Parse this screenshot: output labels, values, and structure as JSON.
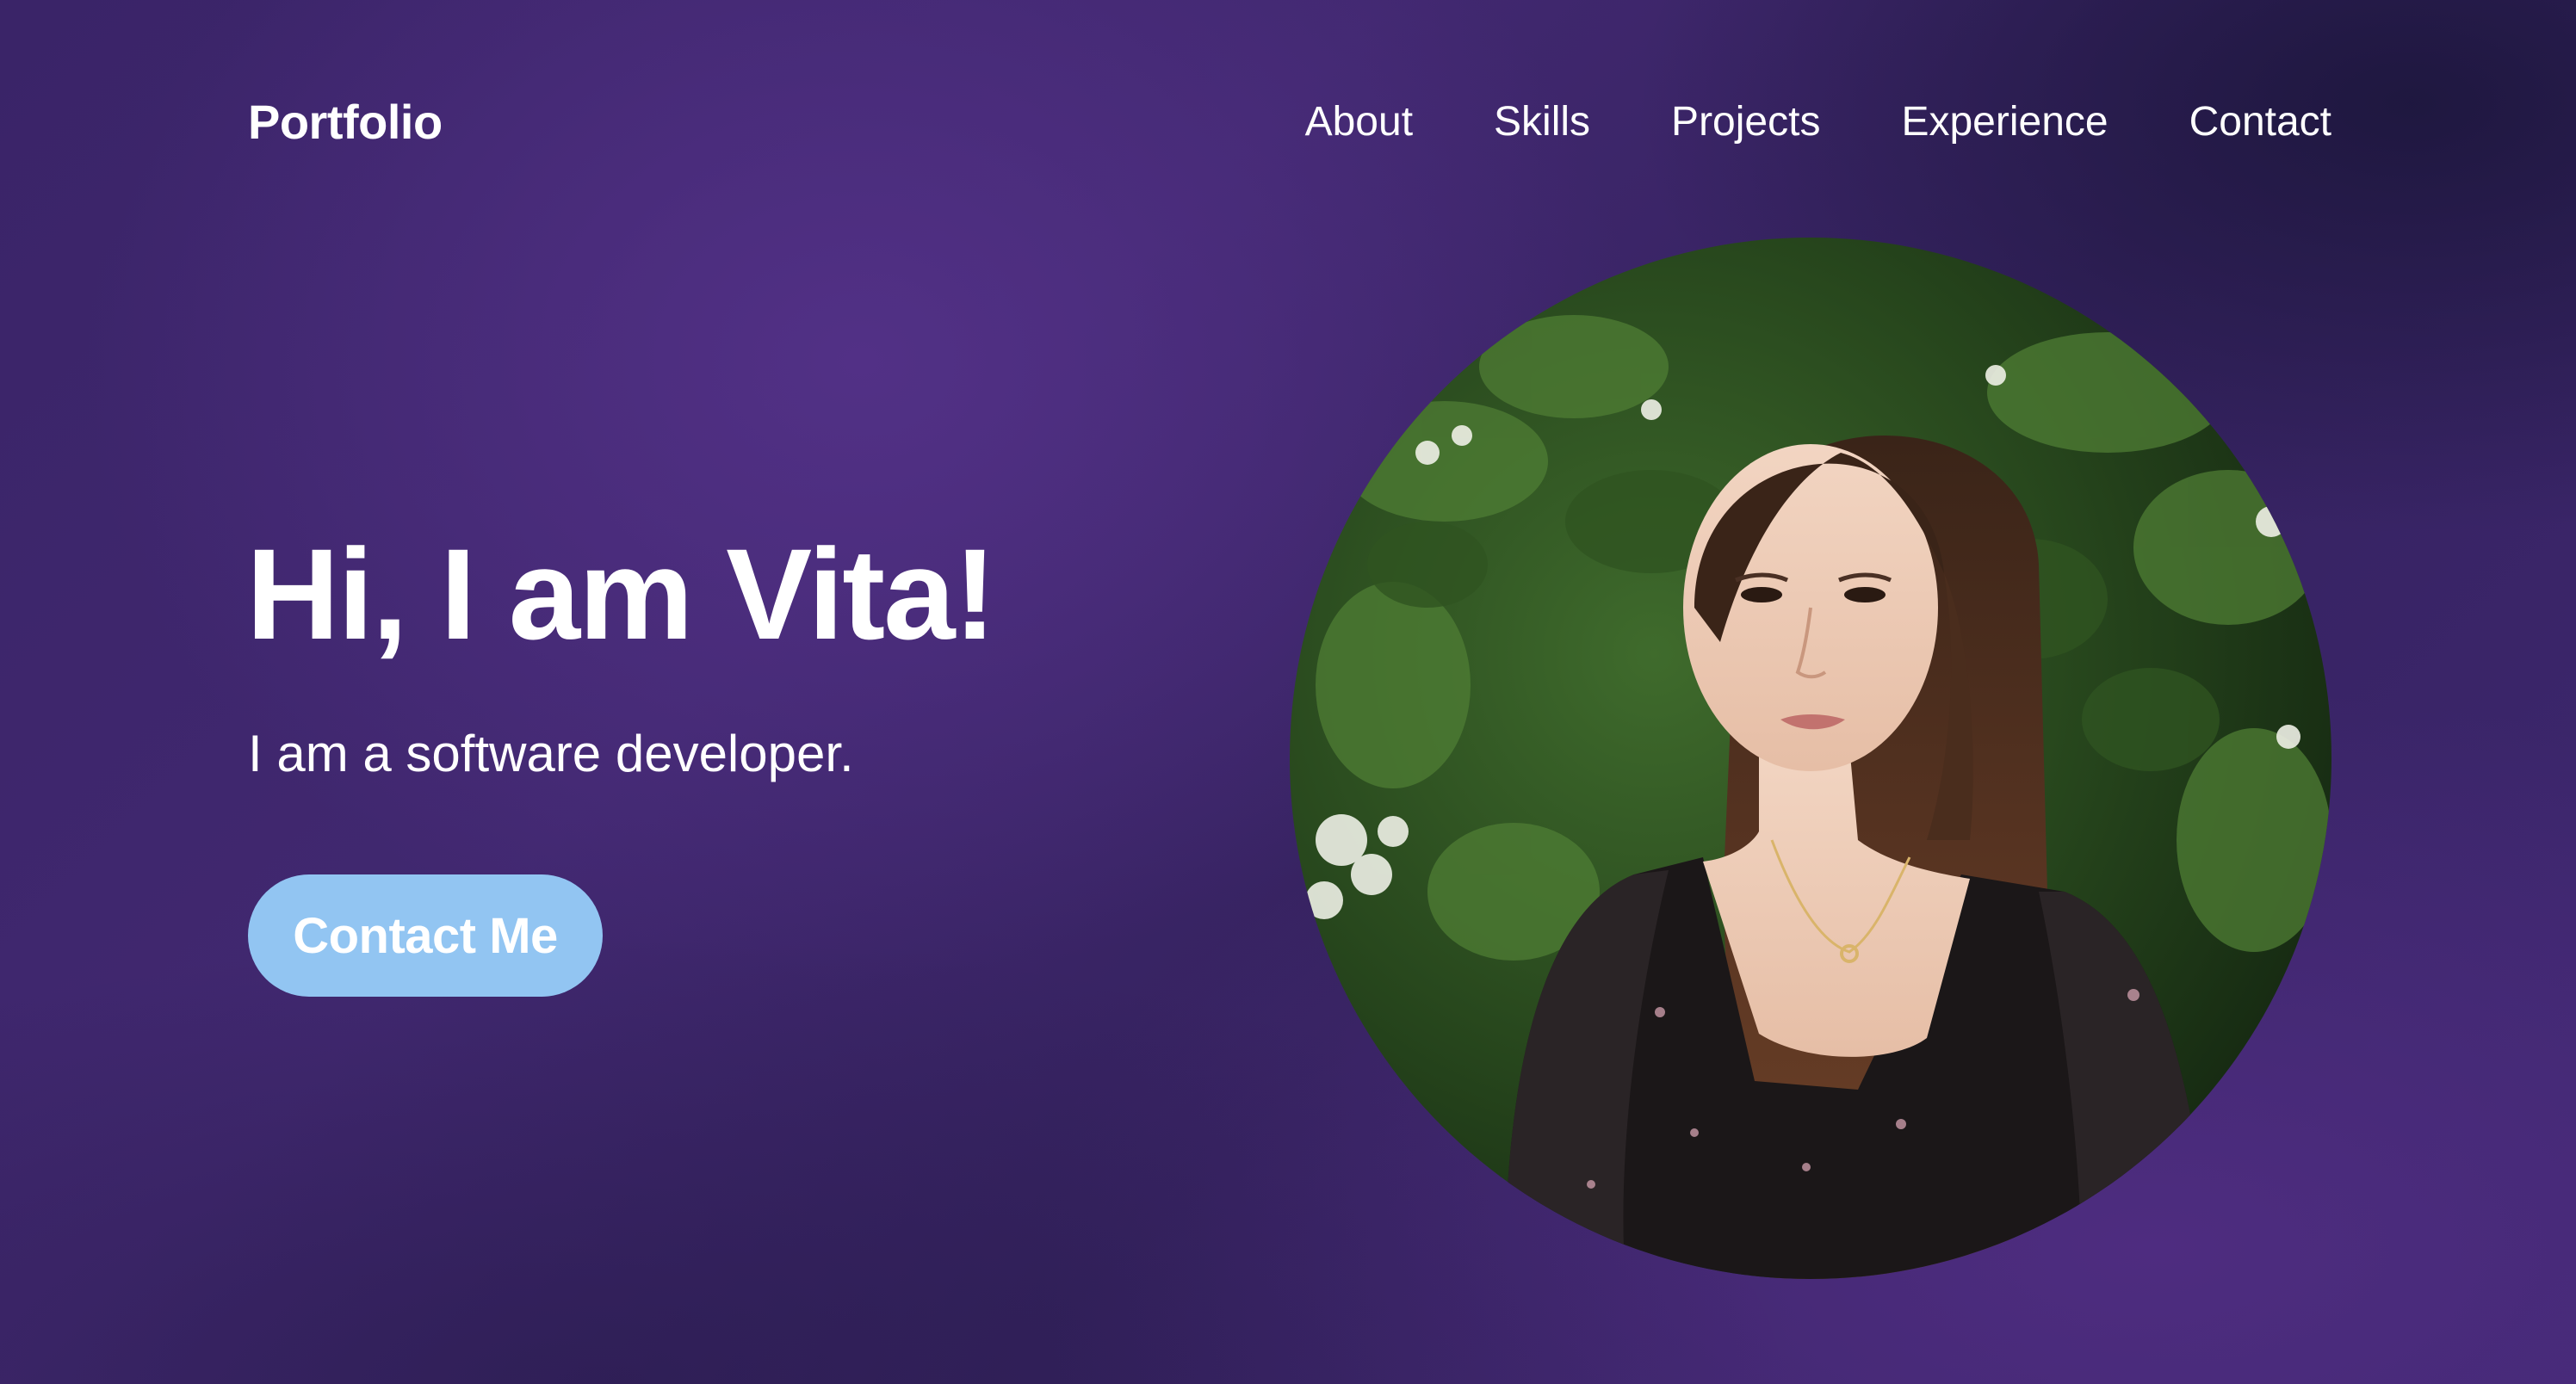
{
  "header": {
    "logo": "Portfolio",
    "nav": [
      {
        "label": "About"
      },
      {
        "label": "Skills"
      },
      {
        "label": "Projects"
      },
      {
        "label": "Experience"
      },
      {
        "label": "Contact"
      }
    ]
  },
  "hero": {
    "title": "Hi, I am Vita!",
    "subtitle": "I am a software developer.",
    "cta_label": "Contact Me"
  },
  "profile_photo": {
    "icon": "profile-photo",
    "shape": "circle"
  },
  "colors": {
    "background": "#3b2668",
    "button": "#92c5f2",
    "text": "#ffffff"
  }
}
